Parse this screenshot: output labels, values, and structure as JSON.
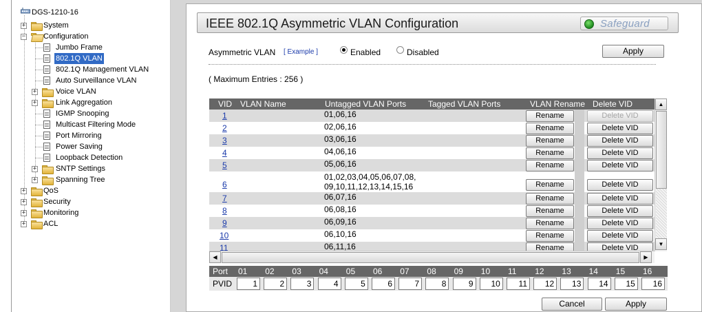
{
  "tree": {
    "root": "DGS-1210-16",
    "items": [
      {
        "label": "System",
        "type": "folder",
        "level": 1,
        "expander": "+"
      },
      {
        "label": "Configuration",
        "type": "folder-open",
        "level": 1,
        "expander": "−"
      },
      {
        "label": "Jumbo Frame",
        "type": "doc",
        "level": 2
      },
      {
        "label": "802.1Q VLAN",
        "type": "doc",
        "level": 2,
        "selected": true
      },
      {
        "label": "802.1Q Management VLAN",
        "type": "doc",
        "level": 2
      },
      {
        "label": "Auto Surveillance VLAN",
        "type": "doc",
        "level": 2
      },
      {
        "label": "Voice VLAN",
        "type": "folder",
        "level": 2,
        "expander": "+"
      },
      {
        "label": "Link Aggregation",
        "type": "folder",
        "level": 2,
        "expander": "+"
      },
      {
        "label": "IGMP Snooping",
        "type": "doc",
        "level": 2
      },
      {
        "label": "Multicast Filtering Mode",
        "type": "doc",
        "level": 2
      },
      {
        "label": "Port Mirroring",
        "type": "doc",
        "level": 2
      },
      {
        "label": "Power Saving",
        "type": "doc",
        "level": 2
      },
      {
        "label": "Loopback Detection",
        "type": "doc",
        "level": 2
      },
      {
        "label": "SNTP Settings",
        "type": "folder",
        "level": 2,
        "expander": "+"
      },
      {
        "label": "Spanning Tree",
        "type": "folder",
        "level": 2,
        "expander": "+"
      },
      {
        "label": "QoS",
        "type": "folder",
        "level": 1,
        "expander": "+"
      },
      {
        "label": "Security",
        "type": "folder",
        "level": 1,
        "expander": "+"
      },
      {
        "label": "Monitoring",
        "type": "folder",
        "level": 1,
        "expander": "+"
      },
      {
        "label": "ACL",
        "type": "folder",
        "level": 1,
        "expander": "+"
      }
    ]
  },
  "header": {
    "title": "IEEE 802.1Q Asymmetric VLAN Configuration",
    "safeguard": "Safeguard"
  },
  "asym": {
    "label": "Asymmetric VLAN",
    "example": "[ Example ]",
    "enabled": "Enabled",
    "disabled": "Disabled",
    "selected": "enabled",
    "apply": "Apply"
  },
  "max_entries": "( Maximum Entries : 256 )",
  "table": {
    "headers": {
      "vid": "VID",
      "name": "VLAN Name",
      "untagged": "Untagged VLAN Ports",
      "tagged": "Tagged VLAN Ports",
      "rename": "VLAN Rename",
      "delete": "Delete VID"
    },
    "rename_label": "Rename",
    "delete_label": "Delete VID",
    "rows": [
      {
        "vid": "1",
        "untagged": "01,06,16",
        "delete_disabled": true
      },
      {
        "vid": "2",
        "untagged": "02,06,16"
      },
      {
        "vid": "3",
        "untagged": "03,06,16"
      },
      {
        "vid": "4",
        "untagged": "04,06,16"
      },
      {
        "vid": "5",
        "untagged": "05,06,16"
      },
      {
        "vid": "6",
        "untagged": "01,02,03,04,05,06,07,08,",
        "untagged2": "09,10,11,12,13,14,15,16"
      },
      {
        "vid": "7",
        "untagged": "06,07,16"
      },
      {
        "vid": "8",
        "untagged": "06,08,16"
      },
      {
        "vid": "9",
        "untagged": "06,09,16"
      },
      {
        "vid": "10",
        "untagged": "06,10,16"
      },
      {
        "vid": "11",
        "untagged": "06,11,16"
      }
    ]
  },
  "ports": {
    "port_label": "Port",
    "pvid_label": "PVID",
    "numbers": [
      "01",
      "02",
      "03",
      "04",
      "05",
      "06",
      "07",
      "08",
      "09",
      "10",
      "11",
      "12",
      "13",
      "14",
      "15",
      "16"
    ],
    "pvids": [
      "1",
      "2",
      "3",
      "4",
      "5",
      "6",
      "7",
      "8",
      "9",
      "10",
      "11",
      "12",
      "13",
      "14",
      "15",
      "16"
    ]
  },
  "footer": {
    "cancel": "Cancel",
    "apply": "Apply"
  },
  "colors": {
    "header_bg": "#666666",
    "selected_bg": "#316ac5",
    "link": "#1a3aaa"
  }
}
